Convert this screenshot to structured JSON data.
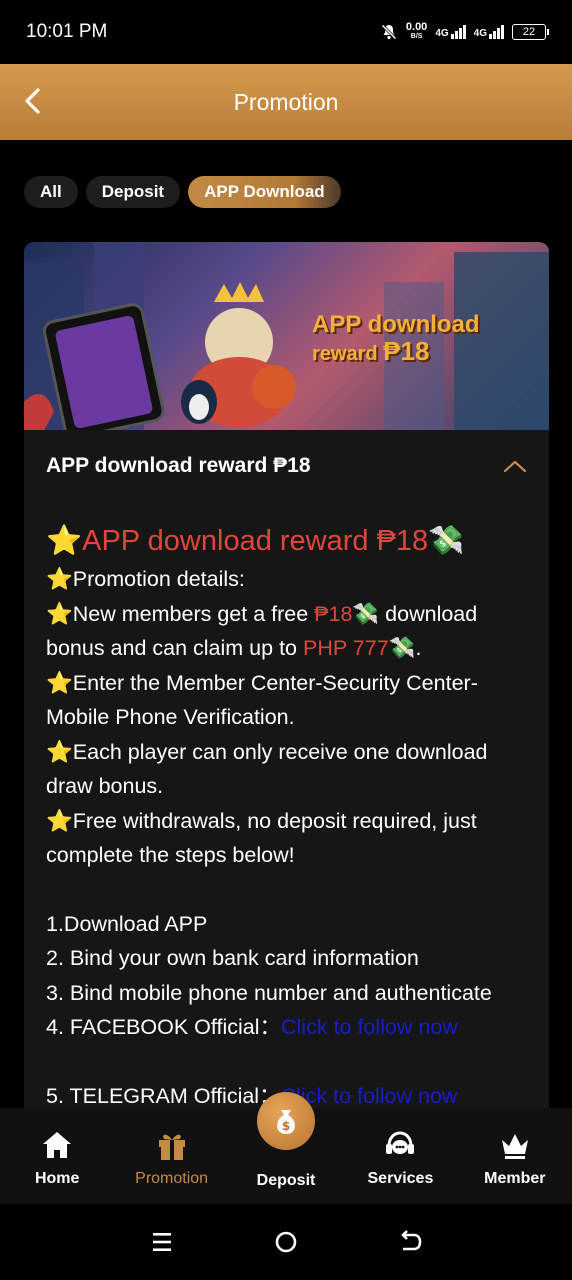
{
  "status_bar": {
    "time": "10:01 PM",
    "speed_value": "0.00",
    "speed_unit": "B/S",
    "net1": "4G",
    "net2": "4G",
    "battery": "22"
  },
  "header": {
    "title": "Promotion"
  },
  "tabs": [
    {
      "label": "All",
      "active": false
    },
    {
      "label": "Deposit",
      "active": false
    },
    {
      "label": "APP Download",
      "active": true
    }
  ],
  "banner": {
    "line1": "APP download",
    "line2_prefix": "reward ",
    "line2_amount": "₱18"
  },
  "promo": {
    "title": "APP download reward ₱18",
    "headline_star": "⭐",
    "headline": "APP download reward ₱18",
    "headline_emoji": "💸",
    "p1": "Promotion details:",
    "p2_a": "New members get a free ",
    "p2_b": "₱18",
    "p2_c": " download bonus and can claim up to ",
    "p2_d": "PHP 777",
    "p2_e": ".",
    "p3": "Enter the Member Center-Security Center-Mobile Phone Verification.",
    "p4": "Each player can only receive one download draw bonus.",
    "p5": "Free withdrawals, no deposit required, just complete the steps below!",
    "step1": "1.Download APP",
    "step2": "2. Bind your own bank card information",
    "step3": "3. Bind mobile phone number and authenticate",
    "step4_label": "4. FACEBOOK Official：",
    "step4_link": "Click to follow now",
    "step5_label": "5. TELEGRAM Official：",
    "step5_link": "Click to follow now"
  },
  "bottom_nav": [
    {
      "label": "Home",
      "icon": "home-icon"
    },
    {
      "label": "Promotion",
      "icon": "gift-icon",
      "active": true
    },
    {
      "label": "Deposit",
      "icon": "money-bag-icon"
    },
    {
      "label": "Services",
      "icon": "headset-icon"
    },
    {
      "label": "Member",
      "icon": "crown-icon"
    }
  ],
  "colors": {
    "accent": "#c38a45",
    "header_gradient_top": "#d59a4e",
    "highlight_red": "#e0463b",
    "link_blue": "#1a1dcc",
    "card_bg": "#161616"
  }
}
